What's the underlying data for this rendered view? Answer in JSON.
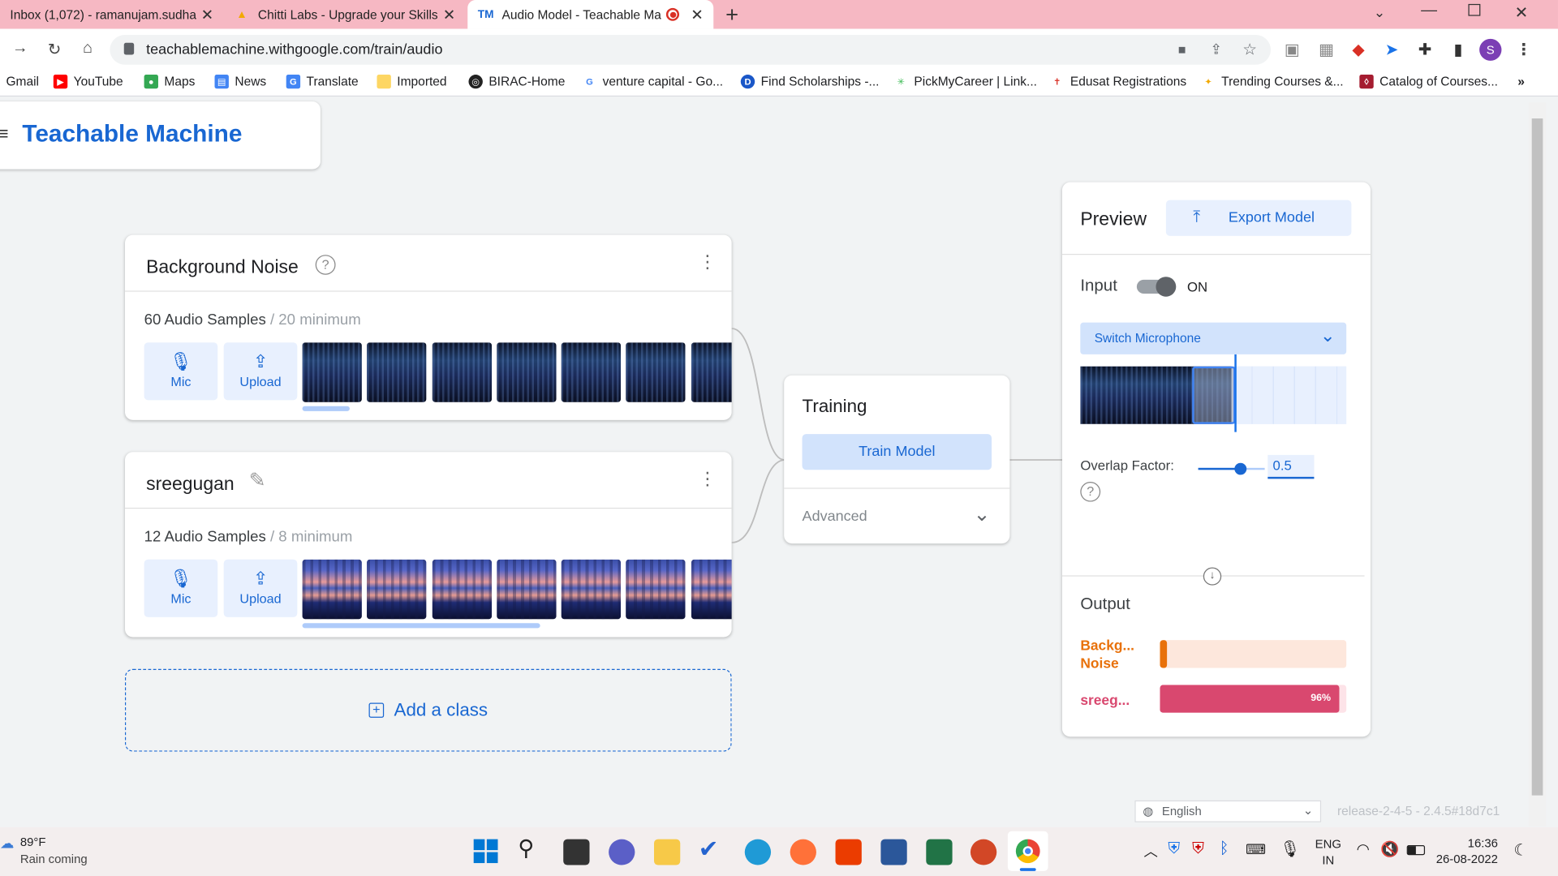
{
  "browser": {
    "tabs": [
      {
        "label": "Inbox (1,072) - ramanujam.sudha"
      },
      {
        "label": "Chitti Labs - Upgrade your Skills"
      },
      {
        "label": "Audio Model - Teachable Ma"
      }
    ],
    "url": "teachablemachine.withgoogle.com/train/audio",
    "bookmarks": [
      "Gmail",
      "YouTube",
      "Maps",
      "News",
      "Translate",
      "Imported",
      "BIRAC-Home",
      "venture capital - Go...",
      "Find Scholarships -...",
      "PickMyCareer | Link...",
      "Edusat Registrations",
      "Trending Courses &...",
      "Catalog of Courses..."
    ],
    "profile_initial": "S"
  },
  "app": {
    "title": "Teachable Machine",
    "classes": [
      {
        "name": "Background Noise",
        "samples": "60 Audio Samples",
        "minimum": "/ 20 minimum",
        "mic": "Mic",
        "upload": "Upload"
      },
      {
        "name": "sreegugan",
        "samples": "12 Audio Samples",
        "minimum": "/ 8 minimum",
        "mic": "Mic",
        "upload": "Upload"
      }
    ],
    "add_class": "Add a class",
    "training": {
      "title": "Training",
      "button": "Train Model",
      "advanced": "Advanced"
    },
    "preview": {
      "title": "Preview",
      "export": "Export Model",
      "input_label": "Input",
      "toggle_state": "ON",
      "mic_select": "Switch Microphone",
      "overlap_label": "Overlap Factor:",
      "overlap_value": "0.5",
      "output_label": "Output",
      "outputs": [
        {
          "label": "Backg... Noise",
          "value": 0.04,
          "color": "#e8710a",
          "track": "#fde7dc"
        },
        {
          "label": "sreeg...",
          "value": 0.96,
          "text": "96%",
          "color": "#d9486f",
          "track": "#fde3e8"
        }
      ]
    },
    "language": "English",
    "version": "release-2-4-5 - 2.4.5#18d7c1"
  },
  "taskbar": {
    "weather_temp": "89°F",
    "weather_text": "Rain coming",
    "lang1": "ENG",
    "lang2": "IN",
    "time": "16:36",
    "date": "26-08-2022"
  }
}
